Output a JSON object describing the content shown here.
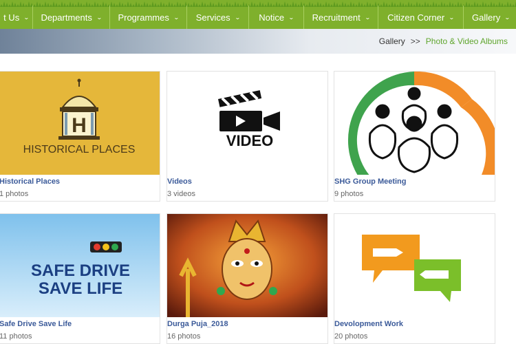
{
  "nav": {
    "items": [
      {
        "label": "t Us",
        "name": "nav-about-us",
        "width": 48
      },
      {
        "label": "Departments",
        "name": "nav-departments",
        "width": 112
      },
      {
        "label": "Programmes",
        "name": "nav-programmes",
        "width": 112
      },
      {
        "label": "Services",
        "name": "nav-services",
        "width": 90
      },
      {
        "label": "Notice",
        "name": "nav-notice",
        "width": 80
      },
      {
        "label": "Recruitment",
        "name": "nav-recruitment",
        "width": 108
      },
      {
        "label": "Citizen Corner",
        "name": "nav-citizen-corner",
        "width": 124
      },
      {
        "label": "Gallery",
        "name": "nav-gallery",
        "width": 80
      }
    ],
    "color": "#7fb02c"
  },
  "breadcrumb": {
    "root": "Gallery",
    "separator": ">>",
    "current": "Photo & Video Albums"
  },
  "albums": [
    {
      "title": "Historical Places",
      "count": "1 photos",
      "thumb_text": "HISTORICAL PLACES"
    },
    {
      "title": "Videos",
      "count": "3 videos",
      "thumb_text": "VIDEO"
    },
    {
      "title": "SHG Group Meeting",
      "count": "9 photos",
      "thumb_text": ""
    },
    {
      "title": "Safe Drive Save Life",
      "count": "11 photos",
      "thumb_text_1": "SAFE DRIVE",
      "thumb_text_2": "SAVE LIFE"
    },
    {
      "title": "Durga Puja_2018",
      "count": "16 photos",
      "thumb_text": ""
    },
    {
      "title": "Devolopment Work",
      "count": "20 photos",
      "thumb_text": ""
    }
  ]
}
